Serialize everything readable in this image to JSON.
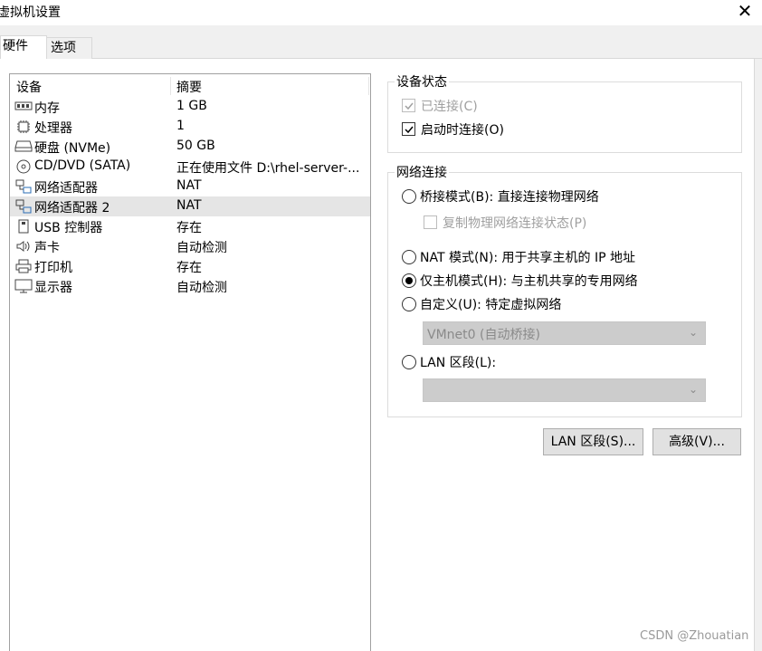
{
  "window": {
    "title": "虚拟机设置",
    "close_glyph": "✕"
  },
  "tabs": [
    {
      "label": "硬件",
      "active": true
    },
    {
      "label": "选项",
      "active": false
    }
  ],
  "device_list": {
    "col_device": "设备",
    "col_summary": "摘要",
    "rows": [
      {
        "icon": "memory-icon",
        "name": "内存",
        "summary": "1 GB"
      },
      {
        "icon": "processor-icon",
        "name": "处理器",
        "summary": "1"
      },
      {
        "icon": "harddisk-icon",
        "name": "硬盘 (NVMe)",
        "summary": "50 GB"
      },
      {
        "icon": "cd-dvd-icon",
        "name": "CD/DVD (SATA)",
        "summary": "正在使用文件 D:\\rhel-server-..."
      },
      {
        "icon": "network-adapter-icon",
        "name": "网络适配器",
        "summary": "NAT"
      },
      {
        "icon": "network-adapter-icon",
        "name": "网络适配器 2",
        "summary": "NAT",
        "selected": true
      },
      {
        "icon": "usb-icon",
        "name": "USB 控制器",
        "summary": "存在"
      },
      {
        "icon": "sound-icon",
        "name": "声卡",
        "summary": "自动检测"
      },
      {
        "icon": "printer-icon",
        "name": "打印机",
        "summary": "存在"
      },
      {
        "icon": "display-icon",
        "name": "显示器",
        "summary": "自动检测"
      }
    ]
  },
  "device_status": {
    "title": "设备状态",
    "connected": {
      "label": "已连接(C)",
      "checked": true,
      "enabled": false
    },
    "connect_at_power_on": {
      "label": "启动时连接(O)",
      "checked": true,
      "enabled": true
    }
  },
  "network_connection": {
    "title": "网络连接",
    "bridged": {
      "label": "桥接模式(B): 直接连接物理网络",
      "selected": false
    },
    "replicate": {
      "label": "复制物理网络连接状态(P)",
      "checked": false,
      "enabled": false
    },
    "nat": {
      "label": "NAT 模式(N): 用于共享主机的 IP 地址",
      "selected": false
    },
    "host_only": {
      "label": "仅主机模式(H): 与主机共享的专用网络",
      "selected": true
    },
    "custom": {
      "label": "自定义(U): 特定虚拟网络",
      "selected": false
    },
    "custom_select": {
      "value": "VMnet0 (自动桥接)"
    },
    "lan_segment": {
      "label": "LAN 区段(L):",
      "selected": false
    },
    "lan_select": {
      "value": ""
    }
  },
  "buttons": {
    "lan_segments": "LAN 区段(S)...",
    "advanced": "高级(V)..."
  },
  "watermark": "CSDN @Zhouatian"
}
